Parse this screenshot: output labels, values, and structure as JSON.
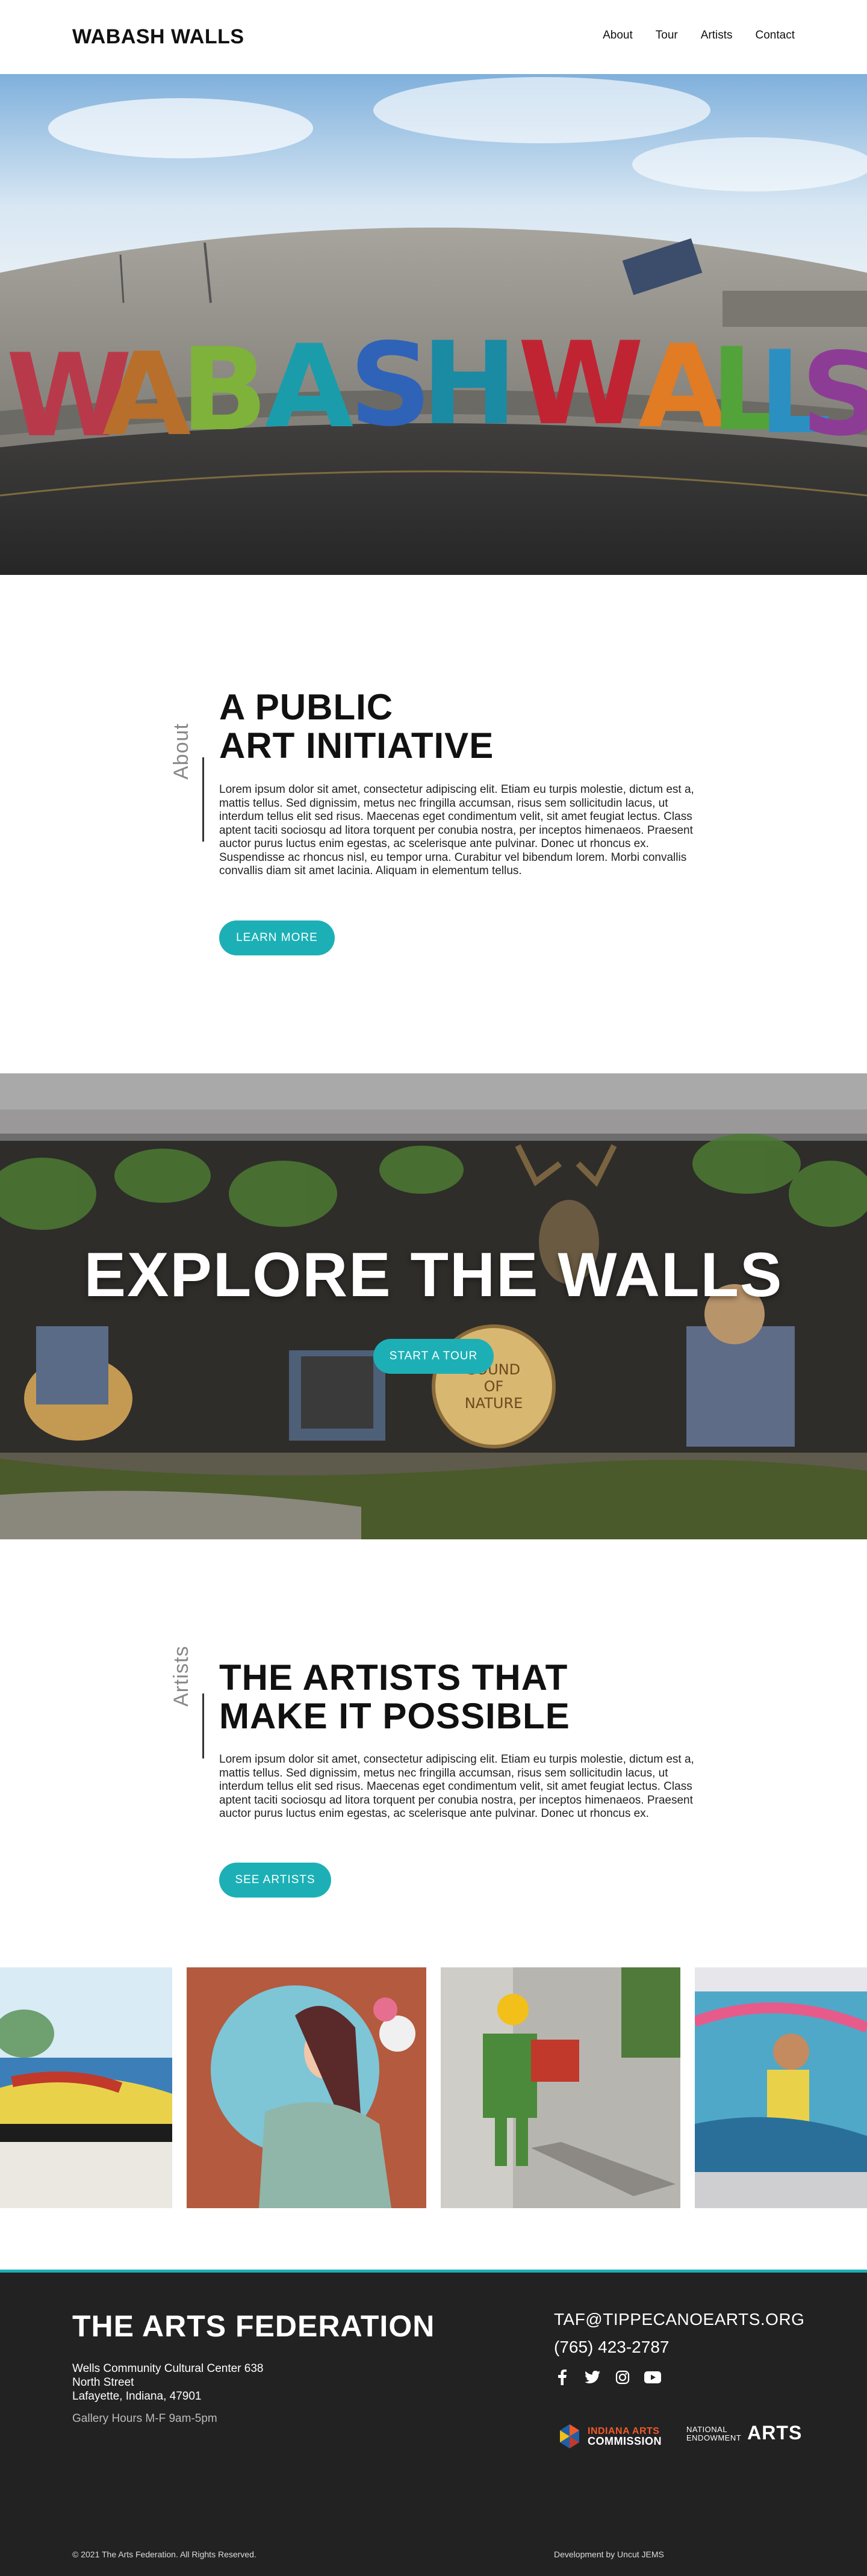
{
  "header": {
    "logo": "WABASH WALLS",
    "nav": [
      "About",
      "Tour",
      "Artists",
      "Contact"
    ]
  },
  "hero": {
    "mural_text": "WABASH WALLS!"
  },
  "about": {
    "label": "About",
    "heading_line1": "A PUBLIC",
    "heading_line2": "ART INITIATIVE",
    "body": "Lorem ipsum dolor sit amet, consectetur adipiscing elit. Etiam eu turpis molestie, dictum est a, mattis tellus. Sed dignissim, metus nec fringilla accumsan, risus sem sollicitudin lacus, ut interdum tellus elit sed risus. Maecenas eget condimentum velit, sit amet feugiat lectus. Class aptent taciti sociosqu ad litora torquent per conubia nostra, per inceptos himenaeos. Praesent auctor purus luctus enim egestas, ac scelerisque ante pulvinar. Donec ut rhoncus ex. Suspendisse ac rhoncus nisl, eu tempor urna. Curabitur vel bibendum lorem. Morbi convallis convallis diam sit amet lacinia. Aliquam in elementum tellus.",
    "button": "LEARN MORE"
  },
  "explore": {
    "heading": "EXPLORE THE WALLS",
    "button": "START A TOUR",
    "mural_sign_line1": "SOUND",
    "mural_sign_line2": "OF",
    "mural_sign_line3": "NATURE"
  },
  "artists": {
    "label": "Artists",
    "heading_line1": "THE ARTISTS THAT",
    "heading_line2": "MAKE IT POSSIBLE",
    "body": "Lorem ipsum dolor sit amet, consectetur adipiscing elit. Etiam eu turpis molestie, dictum est a, mattis tellus. Sed dignissim, metus nec fringilla accumsan, risus sem sollicitudin lacus, ut interdum tellus elit sed risus. Maecenas eget condimentum velit, sit amet feugiat lectus. Class aptent taciti sociosqu ad litora torquent per conubia nostra, per inceptos himenaeos. Praesent auctor purus luctus enim egestas, ac scelerisque ante pulvinar. Donec ut rhoncus ex.",
    "button": "SEE ARTISTS"
  },
  "footer": {
    "title": "THE ARTS FEDERATION",
    "address_line1": "Wells Community Cultural Center 638",
    "address_line2": "North Street",
    "address_line3": "Lafayette, Indiana, 47901",
    "hours": "Gallery Hours M-F 9am-5pm",
    "email": "TAF@TIPPECANOEARTS.ORG",
    "phone": "(765) 423-2787",
    "social_icons": [
      "facebook-icon",
      "twitter-icon",
      "instagram-icon",
      "youtube-icon"
    ],
    "partner_iac_line1": "INDIANA ARTS",
    "partner_iac_line2": "COMMISSION",
    "partner_nea_line1": "NATIONAL",
    "partner_nea_line2": "ENDOWMENT",
    "partner_nea_big": "ARTS",
    "copyright": "© 2021 The Arts Federation. All Rights Reserved.",
    "developer": "Development by Uncut JEMS"
  },
  "colors": {
    "accent": "#1cb0b6",
    "footer_bg": "#222222",
    "text": "#111111"
  }
}
